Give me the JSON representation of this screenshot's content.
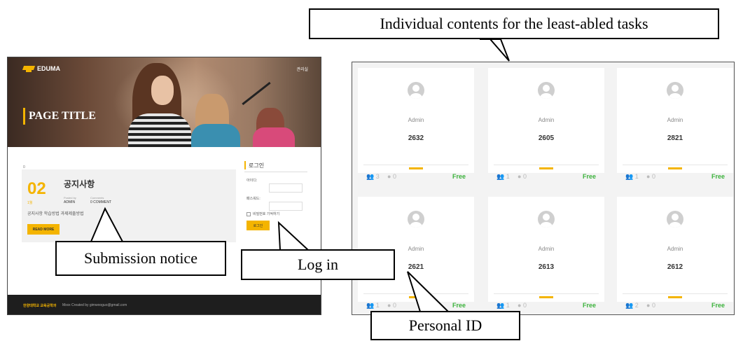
{
  "site": {
    "logo_text": "EDUMA",
    "header_right": "관리실",
    "page_title": "PAGE TITLE",
    "main_zero": "0",
    "notice": {
      "day": "02",
      "month": "1월",
      "title": "공지사항",
      "posted_by_label": "Posted by",
      "posted_by": "ADMIN",
      "comments_label": "Comments",
      "comments": "0 COMMENT",
      "excerpt": "공지사항 학습방법 과제제출방법",
      "read_more": "READ MORE"
    },
    "login": {
      "title": "로그인",
      "id_label": "아이디:",
      "pw_label": "패스워드:",
      "remember": "비밀번호 기억하기",
      "button": "로그인"
    },
    "footer": {
      "brand": "한양대학교 교육공학과",
      "text": "Mxxx Created by gimwooguo@gmail.com"
    }
  },
  "cards": [
    {
      "author": "Admin",
      "id": "2632",
      "users": "3",
      "comments": "0",
      "price": "Free"
    },
    {
      "author": "Admin",
      "id": "2605",
      "users": "1",
      "comments": "0",
      "price": "Free"
    },
    {
      "author": "Admin",
      "id": "2821",
      "users": "1",
      "comments": "0",
      "price": "Free"
    },
    {
      "author": "Admin",
      "id": "2621",
      "users": "1",
      "comments": "0",
      "price": "Free"
    },
    {
      "author": "Admin",
      "id": "2613",
      "users": "1",
      "comments": "0",
      "price": "Free"
    },
    {
      "author": "Admin",
      "id": "2612",
      "users": "2",
      "comments": "0",
      "price": "Free"
    }
  ],
  "callouts": {
    "individual_contents": "Individual contents for the least-abled tasks",
    "submission_notice": "Submission notice",
    "log_in": "Log in",
    "personal_id": "Personal ID"
  },
  "colors": {
    "accent": "#f4b400",
    "free": "#3db33d",
    "footer": "#1e1e1e"
  }
}
